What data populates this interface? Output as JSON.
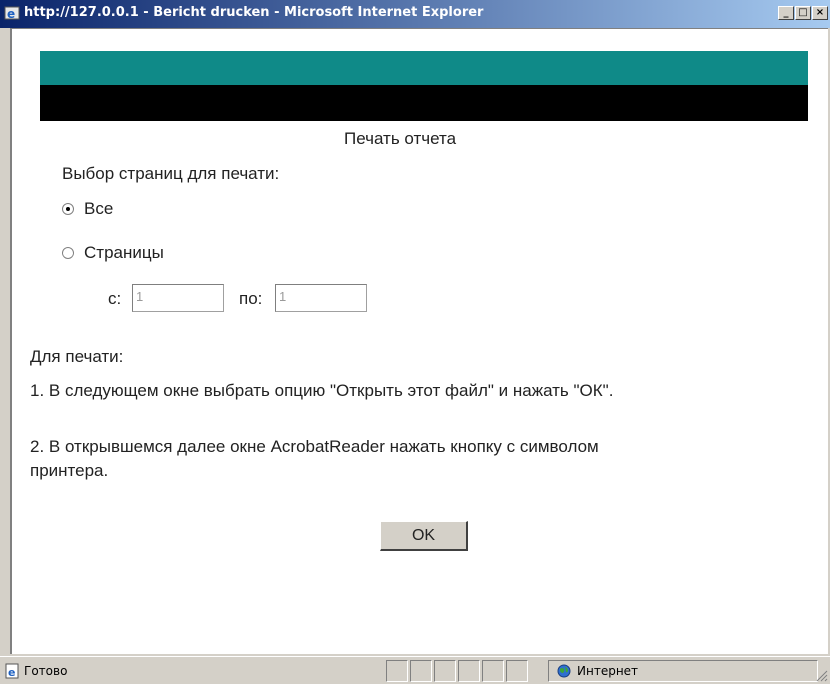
{
  "window": {
    "title": "http://127.0.0.1 - Bericht drucken - Microsoft Internet Explorer",
    "minimize": "_",
    "maximize": "□",
    "close": "×",
    "title_color": "#0a246a"
  },
  "page": {
    "heading": "Печать отчета",
    "selection_label": "Выбор страниц для печати:",
    "option_all": "Все",
    "option_pages": "Страницы",
    "option_all_checked": true,
    "from_label": "с:",
    "from_value": "1",
    "to_label": "по:",
    "to_value": "1",
    "instructions_title": "Для печати:",
    "instruction_1": "1. В следующем окне выбрать опцию \"Открыть этот файл\" и нажать \"ОК\".",
    "instruction_2_line1": "2. В открывшемся далее окне AcrobatReader нажать кнопку с символом",
    "instruction_2_line2": "принтера.",
    "ok_button": "OK",
    "banner_colors": {
      "teal": "#0f8a88",
      "black": "#000000"
    }
  },
  "statusbar": {
    "status": "Готово",
    "zone": "Интернет",
    "icons": {
      "status": "ie-page-icon",
      "zone": "globe-icon"
    }
  }
}
